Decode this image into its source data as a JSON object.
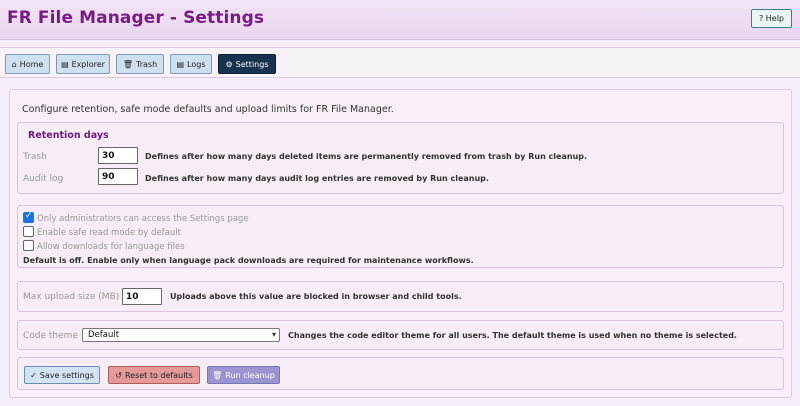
{
  "app": {
    "title": "FR File Manager - Settings",
    "help_label": "? Help"
  },
  "nav": [
    {
      "label": "Home",
      "icon": "⌂"
    },
    {
      "label": "Explorer",
      "icon": "▤"
    },
    {
      "label": "Trash",
      "icon": "🗑"
    },
    {
      "label": "Logs",
      "icon": "▤"
    },
    {
      "label": "Settings",
      "icon": "⚙",
      "active": true
    }
  ],
  "intro": "Configure retention, safe mode defaults and upload limits for FR File Manager.",
  "retention": {
    "title": "Retention days",
    "trash_label": "Trash",
    "trash_value": "30",
    "trash_help": "Defines after how many days deleted items are permanently removed from trash by Run cleanup.",
    "audit_label": "Audit log",
    "audit_value": "90",
    "audit_help": "Defines after how many days audit log entries are removed by Run cleanup."
  },
  "options": {
    "admin_only_label": "Only administrators can access the Settings page",
    "admin_only_checked": true,
    "safe_mode_label": "Enable safe read mode by default",
    "safe_mode_checked": false,
    "lang_dl_label": "Allow downloads for language files",
    "lang_dl_checked": false,
    "lang_dl_note": "Default is off. Enable only when language pack downloads are required for maintenance workflows."
  },
  "upload": {
    "label": "Max upload size (MB)",
    "value": "10",
    "help": "Uploads above this value are blocked in browser and child tools."
  },
  "theme": {
    "label": "Code theme",
    "selected": "Default",
    "help": "Changes the code editor theme for all users. The default theme is used when no theme is selected."
  },
  "actions": {
    "save_label": "Save settings",
    "reset_label": "Reset to defaults",
    "cleanup_label": "Run cleanup"
  }
}
